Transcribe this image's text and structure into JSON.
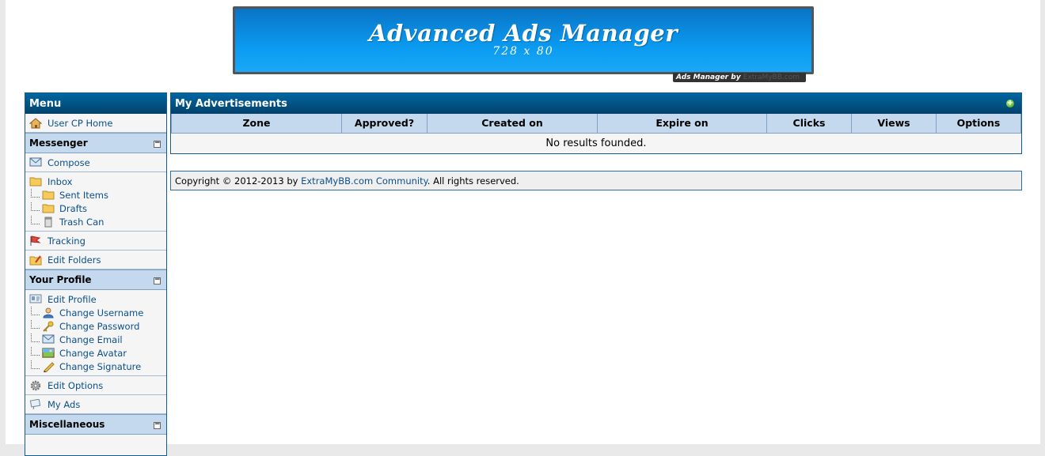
{
  "banner": {
    "title": "Advanced Ads Manager",
    "size": "728 x 80",
    "credit_label": "Ads Manager by",
    "credit_link": "ExtraMyBB.com"
  },
  "sidebar": {
    "header": "Menu",
    "home": "User CP Home",
    "messenger": {
      "title": "Messenger",
      "compose": "Compose",
      "inbox": "Inbox",
      "sent": "Sent Items",
      "drafts": "Drafts",
      "trash": "Trash Can",
      "tracking": "Tracking",
      "edit_folders": "Edit Folders"
    },
    "profile": {
      "title": "Your Profile",
      "edit_profile": "Edit Profile",
      "change_username": "Change Username",
      "change_password": "Change Password",
      "change_email": "Change Email",
      "change_avatar": "Change Avatar",
      "change_signature": "Change Signature",
      "edit_options": "Edit Options",
      "my_ads": "My Ads"
    },
    "misc": {
      "title": "Miscellaneous"
    }
  },
  "ads": {
    "title": "My Advertisements",
    "columns": [
      "Zone",
      "Approved?",
      "Created on",
      "Expire on",
      "Clicks",
      "Views",
      "Options"
    ],
    "empty": "No results founded."
  },
  "footer": {
    "prefix": "Copyright © 2012-2013 by",
    "link": "ExtraMyBB.com Community",
    "suffix": ". All rights reserved."
  },
  "colors": {
    "header_blue": "#02426b",
    "category_blue": "#c4d9ee",
    "link_blue": "#0b4f8b"
  }
}
